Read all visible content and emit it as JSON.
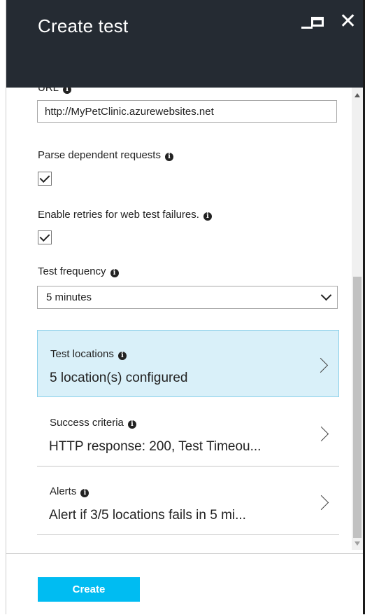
{
  "window": {
    "title": "Create test",
    "controls": [
      "minimize",
      "maximize",
      "close"
    ]
  },
  "form": {
    "url_label": "URL",
    "url_value": "http://MyPetClinic.azurewebsites.net",
    "parse_label": "Parse dependent requests",
    "parse_checked": true,
    "retries_label": "Enable retries for web test failures.",
    "retries_checked": true,
    "frequency_label": "Test frequency",
    "frequency_value": "5 minutes"
  },
  "rows": [
    {
      "label": "Test locations",
      "value": "5 location(s) configured",
      "selected": true
    },
    {
      "label": "Success criteria",
      "value": "HTTP response: 200, Test Timeou...",
      "selected": false
    },
    {
      "label": "Alerts",
      "value": "Alert if 3/5 locations fails in 5 mi...",
      "selected": false
    }
  ],
  "footer": {
    "create_label": "Create"
  },
  "colors": {
    "titlebar": "#252b33",
    "accent": "#00bcf2",
    "selected_row": "#d9f0f9"
  }
}
